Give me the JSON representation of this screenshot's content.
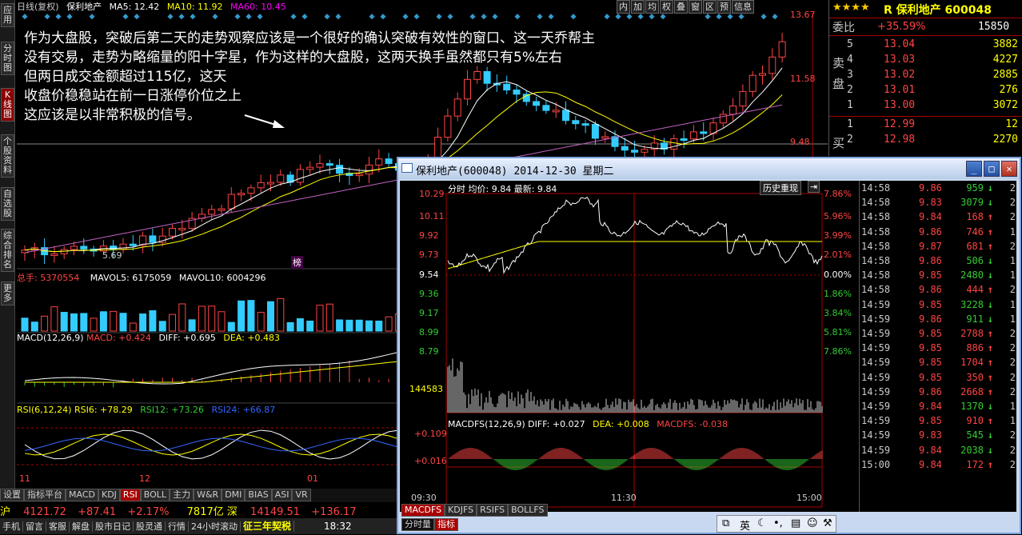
{
  "leftbar": [
    "应用",
    "分时图",
    "K线图",
    "个股资料",
    "自选股",
    "综合排名",
    "更多"
  ],
  "header": {
    "mode": "日线(复权)",
    "name": "保利地产",
    "ma5": "MA5: 12.42",
    "ma10": "MA10: 11.92",
    "ma60": "MA60: 10.45"
  },
  "toolbar": [
    "内",
    "加",
    "均",
    "权",
    "叠",
    "窗",
    "区",
    "预",
    "信息"
  ],
  "annotation": {
    "line1": "作为大盘股，突破后第二天的走势观察应该是一个很好的确认突破有效性的窗口、这一天乔帮主",
    "line2": "没有交易，走势为略缩量的阳十字星，作为这样的大盘股，这两天换手虽然都只有5%左右",
    "line3": "但两日成交金额超过115亿，这天",
    "line4": "收盘价稳稳站在前一日涨停价位之上",
    "line5": "这应该是以非常积极的信号。"
  },
  "price_axis": [
    "13.67",
    "11.58",
    "9.48"
  ],
  "low_marker": "5.69",
  "bang": "榜",
  "vol": {
    "label": "总手: 5370554",
    "mavol5": "MAVOL5: 6175059",
    "mavol10": "MAVOL10: 6004296"
  },
  "macd": {
    "label": "MACD(12,26,9)",
    "macd": "MACD: +0.424",
    "diff": "DIFF: +0.695",
    "dea": "DEA: +0.483"
  },
  "rsi": {
    "label": "RSI(6,12,24)",
    "rsi6": "RSI6: +78.29",
    "rsi12": "RSI12: +73.26",
    "rsi24": "RSI24: +66.87"
  },
  "xaxis": [
    "11",
    "12",
    "01"
  ],
  "bottom_tabs": [
    "设置",
    "指标平台",
    "MACD",
    "KDJ",
    "RSI",
    "BOLL",
    "主力",
    "W&R",
    "DMI",
    "BIAS",
    "ASI",
    "VR"
  ],
  "status1": {
    "idx": "沪",
    "val": "4121.72",
    "chg": "+87.41",
    "pct": "+2.17%",
    "amt": "7817亿",
    "idx2": "深",
    "val2": "14149.51",
    "chg2": "+136.17"
  },
  "status2": [
    "手机",
    "留言",
    "客服",
    "解盘",
    "股市日记",
    "股灵通",
    "行情",
    "24小时滚动",
    "征三年契税",
    "18:32"
  ],
  "quote": {
    "stars": "★★★★",
    "code_name": "R 保利地产 600048",
    "wb_label": "委比",
    "wb": "+35.59%",
    "wb_vol": "15850",
    "sell_label": "卖盘",
    "buy_label": "买",
    "sells": [
      [
        "5",
        "13.04",
        "3882"
      ],
      [
        "4",
        "13.03",
        "4227"
      ],
      [
        "3",
        "13.02",
        "2885"
      ],
      [
        "2",
        "13.01",
        "276"
      ],
      [
        "1",
        "13.00",
        "3072"
      ]
    ],
    "buys": [
      [
        "1",
        "12.99",
        "12"
      ],
      [
        "2",
        "12.98",
        "2270"
      ]
    ]
  },
  "popup": {
    "title": "保利地产(600048) 2014-12-30 星期二",
    "info": "分时 均价: 9.84 最新: 9.84",
    "history": "历史重现",
    "left_axis": [
      "10.29",
      "10.11",
      "9.92",
      "9.73",
      "9.54",
      "9.36",
      "9.17",
      "8.99",
      "8.79"
    ],
    "right_axis": [
      "7.86%",
      "5.96%",
      "3.99%",
      "2.01%",
      "0.00%",
      "1.86%",
      "3.84%",
      "5.81%",
      "7.86%"
    ],
    "vol_max": "144583",
    "macd": {
      "label": "MACDFS(12,26,9)",
      "diff": "DIFF: +0.027",
      "dea": "DEA: +0.008",
      "macdfs": "MACDFS: -0.038"
    },
    "macd_axis": [
      "+0.109",
      "+0.016"
    ],
    "times": [
      "09:30",
      "11:30",
      "15:00"
    ],
    "tabs": [
      "MACDFS",
      "KDJFS",
      "RSIFS",
      "BOLLFS"
    ],
    "tabs2": [
      "分时量",
      "指标"
    ],
    "trades": [
      [
        "14:58",
        "9.86",
        "959",
        "↓",
        "2"
      ],
      [
        "14:58",
        "9.83",
        "3079",
        "↓",
        "2"
      ],
      [
        "14:58",
        "9.84",
        "168",
        "↑",
        "2"
      ],
      [
        "14:58",
        "9.86",
        "746",
        "↑",
        "1"
      ],
      [
        "14:58",
        "9.87",
        "681",
        "↑",
        "2"
      ],
      [
        "14:58",
        "9.86",
        "506",
        "↓",
        "1"
      ],
      [
        "14:58",
        "9.85",
        "2480",
        "↓",
        "1"
      ],
      [
        "14:58",
        "9.86",
        "444",
        "↑",
        "2"
      ],
      [
        "14:59",
        "9.85",
        "3228",
        "↓",
        "1"
      ],
      [
        "14:59",
        "9.86",
        "911",
        "↓",
        "1"
      ],
      [
        "14:59",
        "9.85",
        "2788",
        "↑",
        "2"
      ],
      [
        "14:59",
        "9.85",
        "886",
        "↑",
        "2"
      ],
      [
        "14:59",
        "9.85",
        "1704",
        "↑",
        "2"
      ],
      [
        "14:59",
        "9.85",
        "350",
        "↑",
        "2"
      ],
      [
        "14:59",
        "9.86",
        "2668",
        "↑",
        "2"
      ],
      [
        "14:59",
        "9.84",
        "1370",
        "↓",
        "1"
      ],
      [
        "14:59",
        "9.85",
        "910",
        "↑",
        "1"
      ],
      [
        "14:59",
        "9.83",
        "545",
        "↓",
        "2"
      ],
      [
        "14:59",
        "9.84",
        "2038",
        "↓",
        "2"
      ],
      [
        "15:00",
        "9.84",
        "172",
        "↑",
        "2"
      ]
    ]
  },
  "ime": "英"
}
